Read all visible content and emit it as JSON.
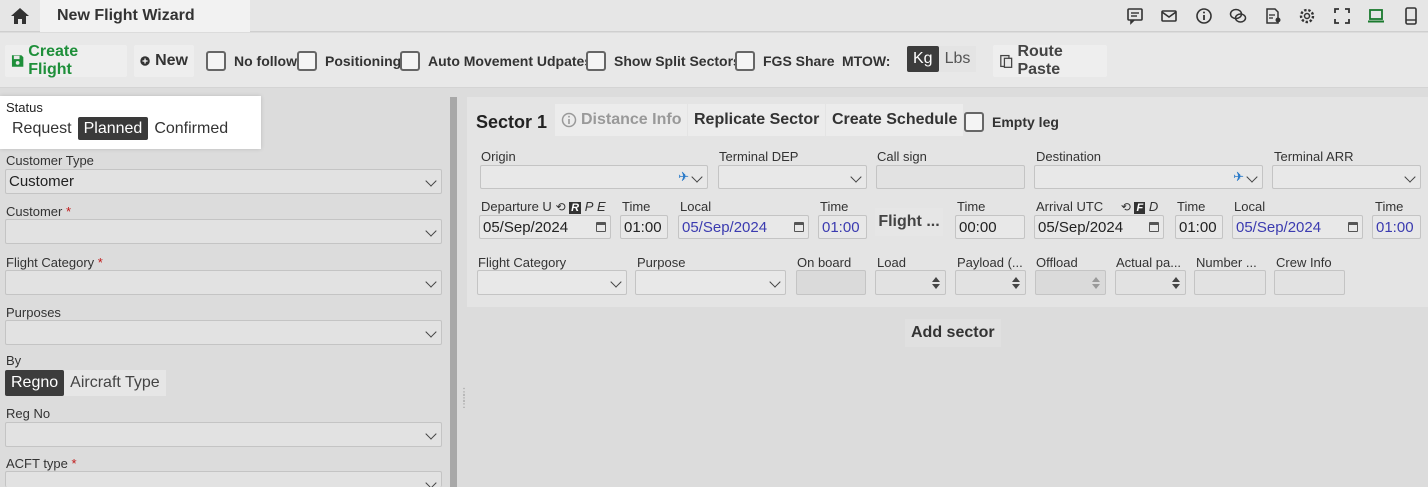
{
  "topbar": {
    "tab_title": "New Flight Wizard",
    "icons": [
      "home-icon",
      "chat-icon",
      "mail-icon",
      "info-icon",
      "conversation-icon",
      "report-icon",
      "gear-icon",
      "fullscreen-icon",
      "laptop-icon",
      "mobile-icon"
    ]
  },
  "toolbar": {
    "create_flight": "Create Flight",
    "new": "New",
    "no_follow": "No follow",
    "positioning": "Positioning",
    "auto_movement": "Auto Movement Udpates",
    "show_split": "Show Split Sectors",
    "fgs_share": "FGS Share",
    "mtow_label": "MTOW:",
    "kg": "Kg",
    "lbs": "Lbs",
    "route_paste": "Route Paste",
    "accent": "#1e8f3a"
  },
  "left": {
    "status_label": "Status",
    "status_options": [
      "Request",
      "Planned",
      "Confirmed"
    ],
    "customer_type_label": "Customer Type",
    "customer_type_value": "Customer",
    "customer_label": "Customer",
    "flight_category_label": "Flight Category",
    "purposes_label": "Purposes",
    "by_label": "By",
    "by_options": [
      "Regno",
      "Aircraft Type"
    ],
    "reg_no_label": "Reg No",
    "acft_type_label": "ACFT type",
    "required_mark": "*"
  },
  "sector": {
    "title": "Sector 1",
    "distance_info": "Distance Info",
    "replicate": "Replicate Sector",
    "create_schedule": "Create Schedule",
    "empty_leg": "Empty leg",
    "origin": "Origin",
    "terminal_dep": "Terminal DEP",
    "call_sign": "Call sign",
    "destination": "Destination",
    "terminal_arr": "Terminal ARR",
    "departure_label": "Departure U",
    "dep_badges": [
      "R",
      "P",
      "E"
    ],
    "time": "Time",
    "local": "Local",
    "dep_date": "05/Sep/2024",
    "dep_time": "01:00",
    "dep_local_date": "05/Sep/2024",
    "dep_local_time": "01:00",
    "flight_btn": "Flight ...",
    "flight_time": "00:00",
    "arrival_label": "Arrival UTC",
    "arr_badges": [
      "F",
      "D"
    ],
    "arr_date": "05/Sep/2024",
    "arr_time": "01:00",
    "arr_local_date": "05/Sep/2024",
    "arr_local_time": "01:00",
    "flight_category": "Flight Category",
    "purpose": "Purpose",
    "on_board": "On board",
    "load": "Load",
    "payload": "Payload (...",
    "offload": "Offload",
    "actual_pa": "Actual pa...",
    "number": "Number ...",
    "crew_info": "Crew Info",
    "add_sector": "Add sector"
  }
}
